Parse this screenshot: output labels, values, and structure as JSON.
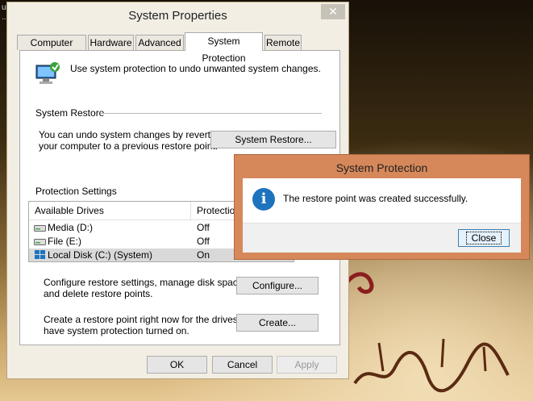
{
  "desktop": {
    "corner_text": [
      "u",
      "..."
    ]
  },
  "window": {
    "title": "System Properties",
    "close_glyph": "✕",
    "tabs": [
      {
        "label": "Computer Name"
      },
      {
        "label": "Hardware"
      },
      {
        "label": "Advanced"
      },
      {
        "label": "System Protection",
        "active": true
      },
      {
        "label": "Remote"
      }
    ],
    "intro": "Use system protection to undo unwanted system changes.",
    "restore": {
      "heading": "System Restore",
      "desc_1": "You can undo system changes by reverting",
      "desc_2": "your computer to a previous restore point.",
      "button": "System Restore..."
    },
    "protection": {
      "heading": "Protection Settings",
      "col_drives": "Available Drives",
      "col_protection": "Protection",
      "drives": [
        {
          "name": "Media (D:)",
          "state": "Off",
          "icon": "hard-drive-icon"
        },
        {
          "name": "File (E:)",
          "state": "Off",
          "icon": "hard-drive-icon"
        },
        {
          "name": "Local Disk (C:) (System)",
          "state": "On",
          "icon": "windows-drive-icon",
          "selected": true
        }
      ]
    },
    "configure": {
      "desc_1": "Configure restore settings, manage disk space,",
      "desc_2": "and delete restore points.",
      "button": "Configure..."
    },
    "create": {
      "desc_1": "Create a restore point right now for the drives that",
      "desc_2": "have system protection turned on.",
      "button": "Create..."
    },
    "footer": {
      "ok": "OK",
      "cancel": "Cancel",
      "apply": "Apply"
    }
  },
  "dialog": {
    "title": "System Protection",
    "message": "The restore point was created successfully.",
    "icon": "info-icon",
    "icon_glyph": "i",
    "close": "Close",
    "accent": "#d6885a"
  }
}
